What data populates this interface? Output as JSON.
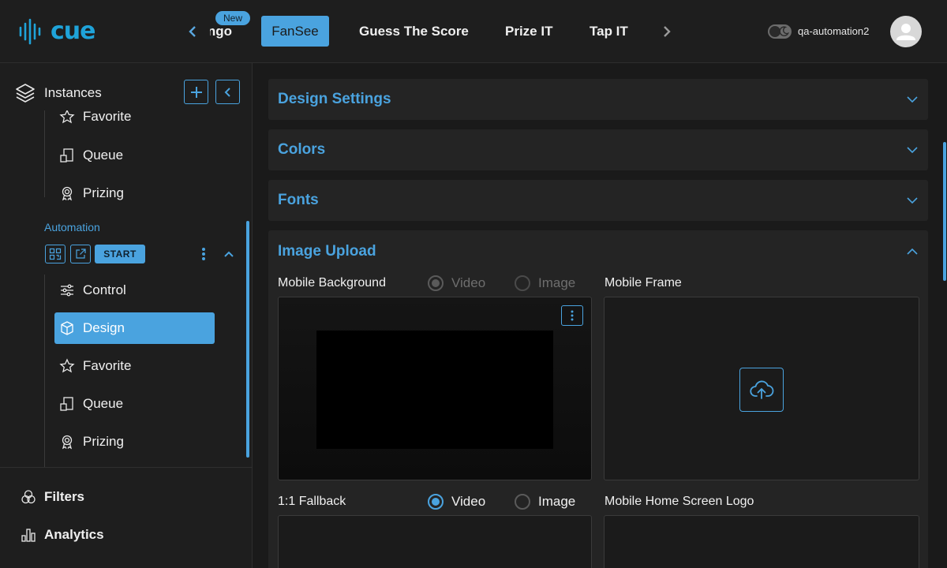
{
  "brand": {
    "logo_text": "cue",
    "accent": "#4aa3df"
  },
  "header": {
    "tabs": [
      {
        "label": "Bingo",
        "badge": "New"
      },
      {
        "label": "FanSee",
        "active": true
      },
      {
        "label": "Guess The Score"
      },
      {
        "label": "Prize IT"
      },
      {
        "label": "Tap IT"
      }
    ],
    "username": "qa-automation2",
    "theme_toggle_icon": "moon-icon"
  },
  "sidebar": {
    "title": "Instances",
    "top_items": [
      {
        "label": "Favorite",
        "icon": "star-icon"
      },
      {
        "label": "Queue",
        "icon": "queue-icon"
      },
      {
        "label": "Prizing",
        "icon": "award-icon"
      }
    ],
    "group": {
      "title": "Automation",
      "start_label": "START",
      "items": [
        {
          "label": "Control",
          "icon": "sliders-icon"
        },
        {
          "label": "Design",
          "icon": "box-icon",
          "active": true
        },
        {
          "label": "Favorite",
          "icon": "star-icon"
        },
        {
          "label": "Queue",
          "icon": "queue-icon"
        },
        {
          "label": "Prizing",
          "icon": "award-icon"
        }
      ]
    },
    "bottom": [
      {
        "label": "Filters",
        "icon": "filters-icon"
      },
      {
        "label": "Analytics",
        "icon": "analytics-icon"
      }
    ]
  },
  "main": {
    "sections": [
      {
        "title": "Design Settings",
        "expanded": false
      },
      {
        "title": "Colors",
        "expanded": false
      },
      {
        "title": "Fonts",
        "expanded": false
      },
      {
        "title": "Image Upload",
        "expanded": true
      }
    ],
    "image_upload": {
      "mobile_background": {
        "label": "Mobile Background",
        "video": "Video",
        "image": "Image",
        "selected": "Video"
      },
      "mobile_frame": {
        "label": "Mobile Frame"
      },
      "fallback": {
        "label": "1:1 Fallback",
        "video": "Video",
        "image": "Image",
        "selected": "Video"
      },
      "home_logo": {
        "label": "Mobile Home Screen Logo"
      }
    }
  }
}
